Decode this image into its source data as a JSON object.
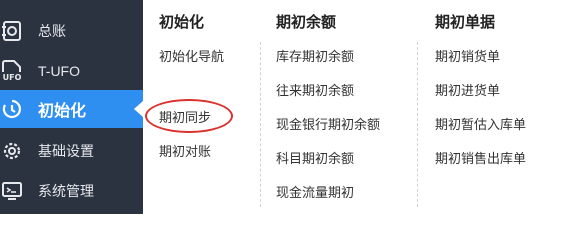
{
  "sidebar": {
    "items": [
      {
        "label": "总账",
        "icon": "ledger-icon"
      },
      {
        "label": "T-UFO",
        "icon": "ufo-icon"
      },
      {
        "label": "初始化",
        "icon": "init-icon",
        "active": true
      },
      {
        "label": "基础设置",
        "icon": "gear-icon"
      },
      {
        "label": "系统管理",
        "icon": "monitor-icon"
      }
    ],
    "active_color": "#2f8ff0",
    "background": "#2c3340"
  },
  "menu": {
    "columns": [
      {
        "title": "初始化",
        "items": [
          "初始化导航",
          "期初同步",
          "期初对账"
        ]
      },
      {
        "title": "期初余额",
        "items": [
          "库存期初余额",
          "往来期初余额",
          "现金银行期初余额",
          "科目期初余额",
          "现金流量期初"
        ]
      },
      {
        "title": "期初单据",
        "items": [
          "期初销货单",
          "期初进货单",
          "期初暂估入库单",
          "期初销售出库单"
        ]
      }
    ]
  },
  "highlight": {
    "target": "期初同步",
    "color": "#d9322f"
  }
}
